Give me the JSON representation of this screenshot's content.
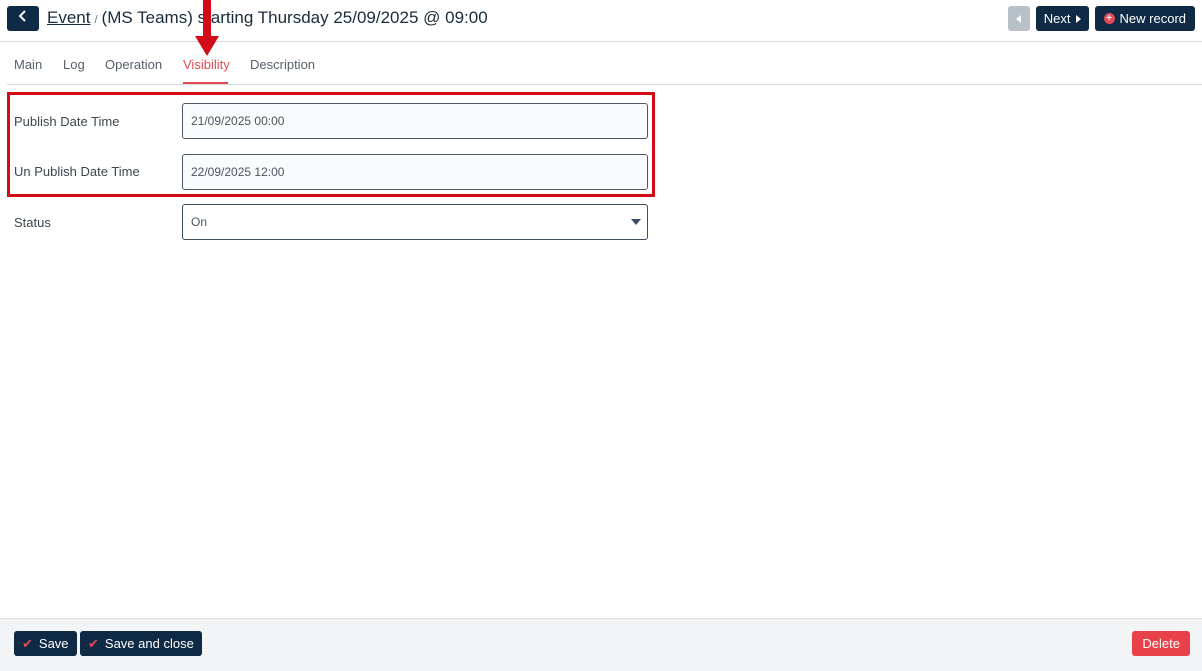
{
  "header": {
    "breadcrumb_link": "Event",
    "breadcrumb_sep": "/",
    "title": "(MS Teams) starting Thursday 25/09/2025 @ 09:00",
    "next_label": "Next",
    "new_record_label": "New record"
  },
  "tabs": [
    {
      "label": "Main"
    },
    {
      "label": "Log"
    },
    {
      "label": "Operation"
    },
    {
      "label": "Visibility"
    },
    {
      "label": "Description"
    }
  ],
  "active_tab": "Visibility",
  "form": {
    "publish": {
      "label": "Publish Date Time",
      "value": "21/09/2025 00:00"
    },
    "unpublish": {
      "label": "Un Publish Date Time",
      "value": "22/09/2025 12:00"
    },
    "status": {
      "label": "Status",
      "value": "On"
    }
  },
  "footer": {
    "save_label": "Save",
    "save_close_label": "Save and close",
    "delete_label": "Delete"
  },
  "colors": {
    "primary": "#0f2a44",
    "accent": "#e04a55",
    "danger": "#e8414a",
    "annotation": "#d10c17"
  },
  "icons": {
    "back": "chevron-left-icon",
    "prev": "caret-left-icon",
    "next": "caret-right-icon",
    "new": "plus-circle-icon",
    "save": "check-icon",
    "select": "caret-down-icon"
  }
}
